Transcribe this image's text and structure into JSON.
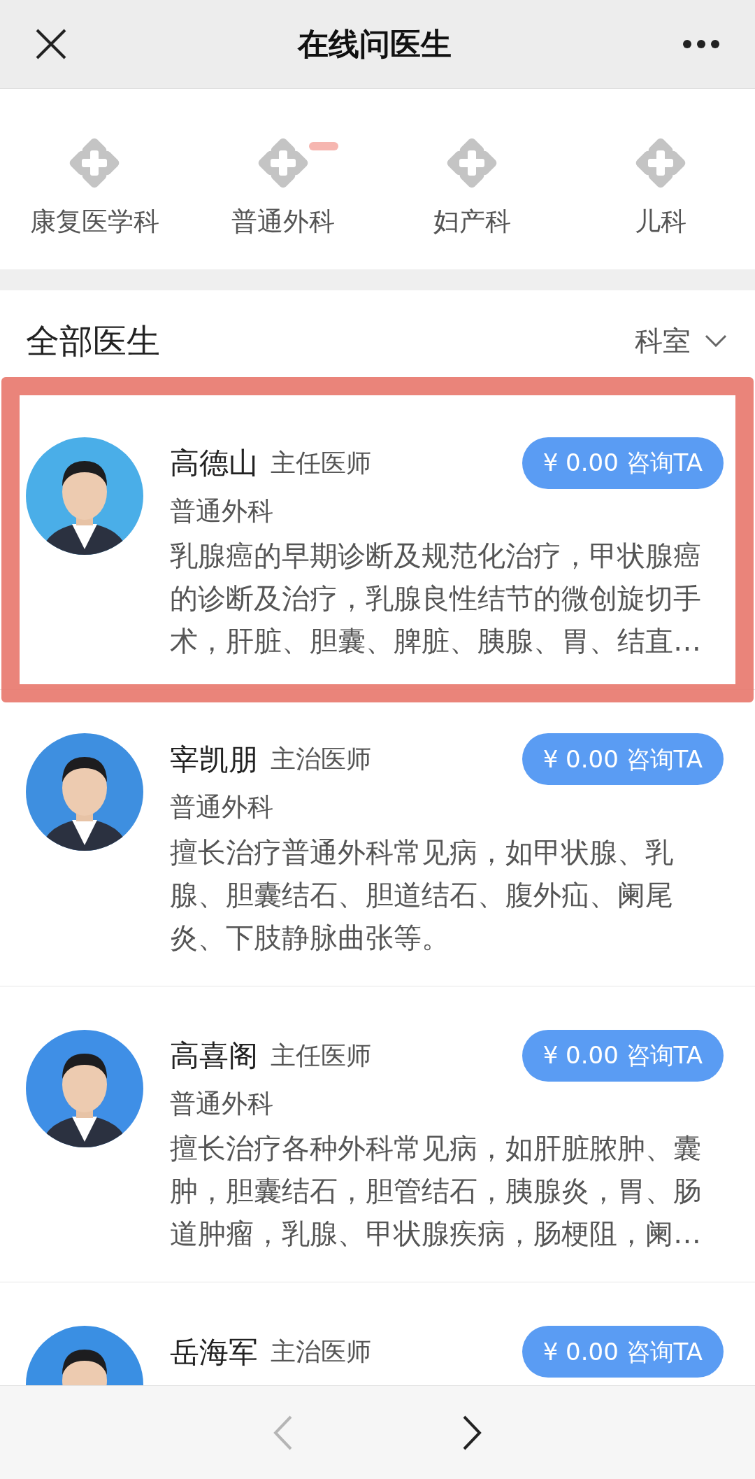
{
  "header": {
    "title": "在线问医生"
  },
  "categories": [
    {
      "label": "康复医学科",
      "marked": false
    },
    {
      "label": "普通外科",
      "marked": true
    },
    {
      "label": "妇产科",
      "marked": false
    },
    {
      "label": "儿科",
      "marked": false
    }
  ],
  "section": {
    "title": "全部医生",
    "filter": "科室"
  },
  "doctors": [
    {
      "name": "高德山",
      "title": "主任医师",
      "specialty": "普通外科",
      "description": "乳腺癌的早期诊断及规范化治疗，甲状腺癌的诊断及治疗，乳腺良性结节的微创旋切手术，肝脏、胆囊、脾脏、胰腺、胃、结直…",
      "button": "¥ 0.00 咨询TA",
      "highlighted": true
    },
    {
      "name": "宰凯朋",
      "title": "主治医师",
      "specialty": "普通外科",
      "description": "擅长治疗普通外科常见病，如甲状腺、乳腺、胆囊结石、胆道结石、腹外疝、阑尾炎、下肢静脉曲张等。",
      "button": "¥ 0.00 咨询TA",
      "highlighted": false
    },
    {
      "name": "高喜阁",
      "title": "主任医师",
      "specialty": "普通外科",
      "description": "擅长治疗各种外科常见病，如肝脏脓肿、囊肿，胆囊结石，胆管结石，胰腺炎，胃、肠道肿瘤，乳腺、甲状腺疾病，肠梗阻，阑…",
      "button": "¥ 0.00 咨询TA",
      "highlighted": false
    },
    {
      "name": "岳海军",
      "title": "主治医师",
      "button": "¥ 0.00 咨询TA",
      "highlighted": false
    }
  ],
  "nav": {
    "back": {
      "disabled": true
    },
    "forward": {
      "disabled": false
    }
  }
}
